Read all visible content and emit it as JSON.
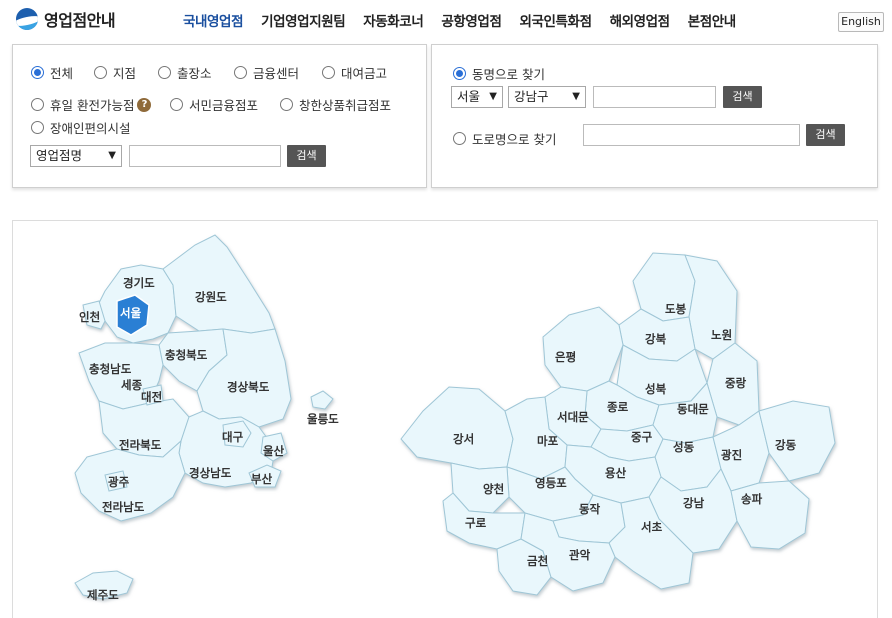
{
  "header": {
    "logo_text": "영업점안내",
    "nav": [
      "국내영업점",
      "기업영업지원팀",
      "자동화코너",
      "공항영업점",
      "외국인특화점",
      "해외영업점",
      "본점안내"
    ],
    "active_nav": "국내영업점",
    "lang_button": "English"
  },
  "left_panel": {
    "filters_row1": [
      "전체",
      "지점",
      "출장소",
      "금융센터",
      "대여금고"
    ],
    "filters_row2": [
      "휴일 환전가능점",
      "서민금융점포",
      "창한상품취급점포"
    ],
    "filters_row3": [
      "장애인편의시설"
    ],
    "selected_filter": "전체",
    "help_icon_glyph": "?",
    "search_type": "영업점명",
    "search_value": "",
    "search_button": "검색"
  },
  "right_panel": {
    "option_dong": "동명으로 찾기",
    "option_road": "도로명으로 찾기",
    "selected_option": "동명으로 찾기",
    "city": "서울",
    "district": "강남구",
    "dong_value": "",
    "road_value": "",
    "search_button": "검색"
  },
  "korea_map": {
    "regions": [
      "경기도",
      "강원도",
      "인천",
      "서울",
      "충청북도",
      "충청남도",
      "세종",
      "대전",
      "경상북도",
      "울릉도",
      "대구",
      "전라북도",
      "울산",
      "경상남도",
      "부산",
      "광주",
      "전라남도",
      "제주도"
    ],
    "selected": "서울",
    "selected_color": "#2a7fd4",
    "region_color": "#e9f7fc"
  },
  "seoul_map": {
    "districts": [
      "도봉",
      "노원",
      "강북",
      "은평",
      "성북",
      "중랑",
      "종로",
      "동대문",
      "서대문",
      "강서",
      "마포",
      "중구",
      "성동",
      "광진",
      "강동",
      "용산",
      "영등포",
      "양천",
      "구로",
      "동작",
      "강남",
      "송파",
      "서초",
      "금천",
      "관악"
    ]
  }
}
